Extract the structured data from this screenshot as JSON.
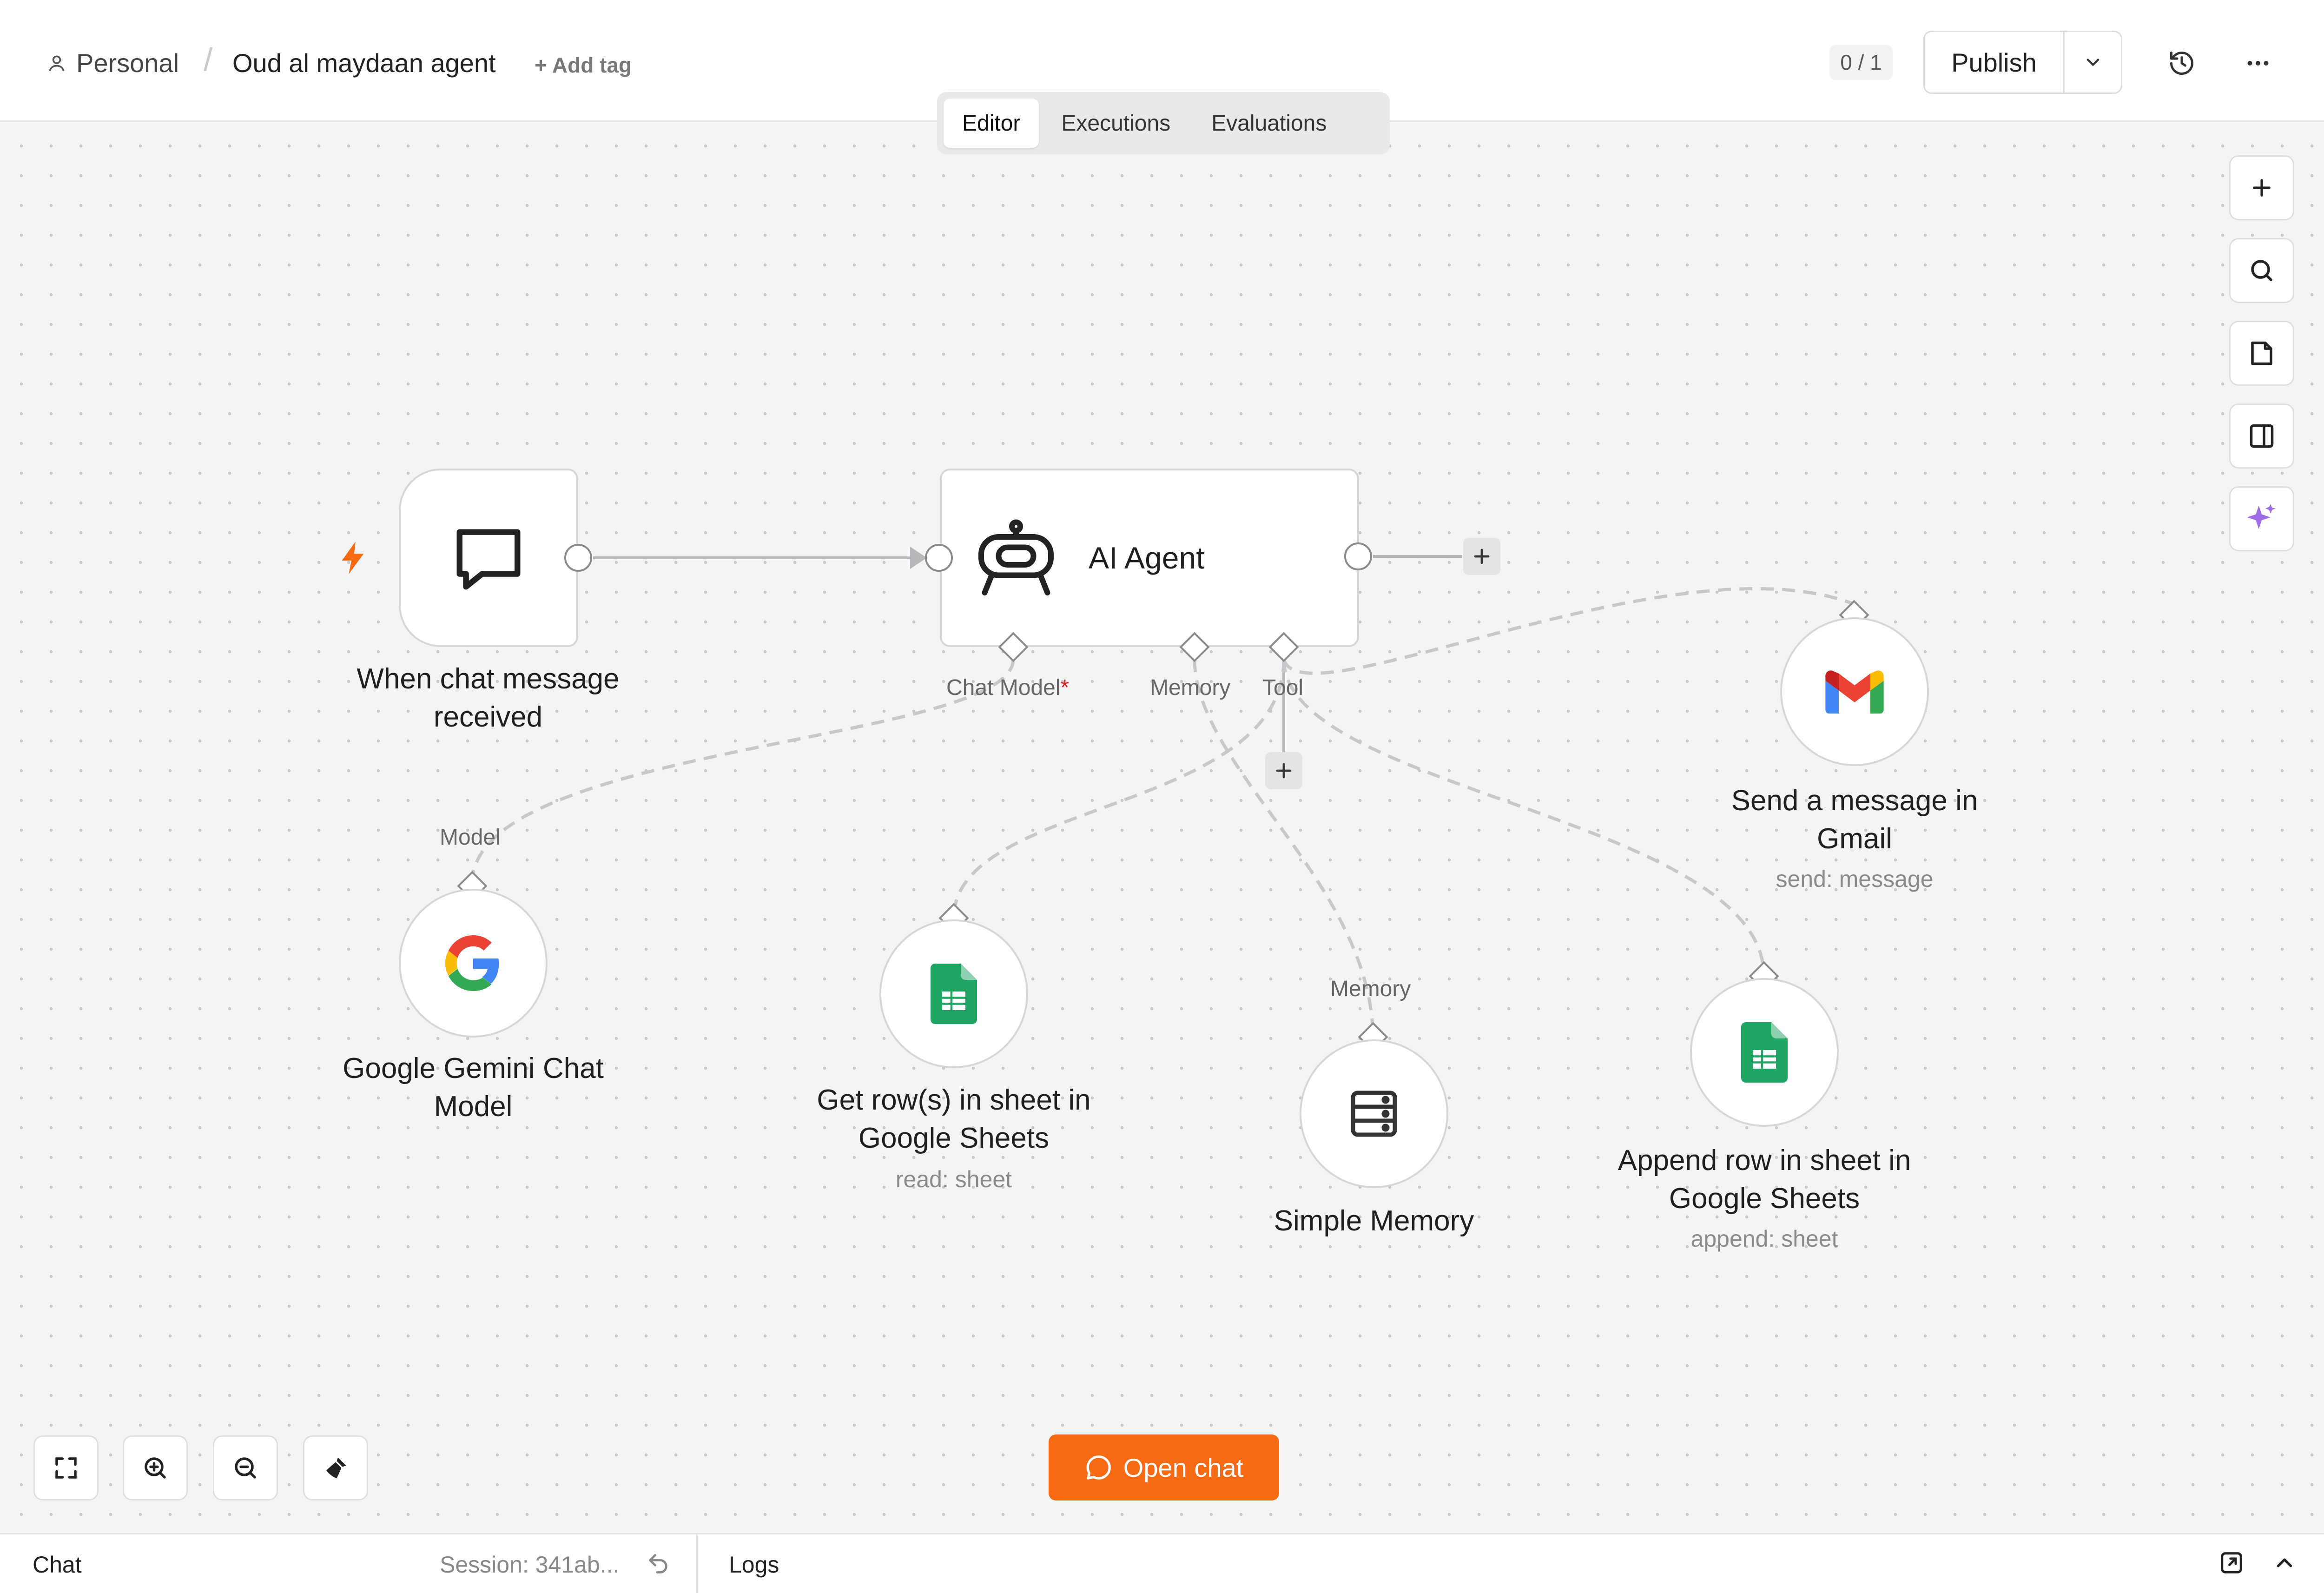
{
  "header": {
    "breadcrumb_project": "Personal",
    "breadcrumb_separator": "/",
    "workflow_name": "Oud al maydaan agent",
    "add_tag": "+ Add tag",
    "counter": "0 / 1",
    "publish_label": "Publish"
  },
  "tabs": [
    "Editor",
    "Executions",
    "Evaluations"
  ],
  "nodes": {
    "trigger": {
      "label": "When chat message received",
      "icon": "chat-bubble-icon"
    },
    "agent": {
      "label": "AI Agent",
      "icon": "robot-icon"
    },
    "gemini": {
      "label": "Google Gemini Chat Model",
      "icon": "google-icon",
      "port_label": "Model"
    },
    "get_rows": {
      "label": "Get row(s) in sheet in Google Sheets",
      "sub": "read: sheet",
      "icon": "google-sheets-icon"
    },
    "memory": {
      "label": "Simple Memory",
      "icon": "database-icon",
      "port_label": "Memory"
    },
    "append_row": {
      "label": "Append row in sheet in Google Sheets",
      "sub": "append: sheet",
      "icon": "google-sheets-icon"
    },
    "gmail": {
      "label": "Send a message in Gmail",
      "sub": "send: message",
      "icon": "gmail-icon"
    }
  },
  "agent_ports": {
    "chat_model": "Chat Model",
    "required_mark": "*",
    "memory": "Memory",
    "tool": "Tool"
  },
  "colors": {
    "accent": "#f56a12",
    "trigger_bolt": "#f56a12",
    "ai_sparkle": "#a06be8",
    "required": "#e02020",
    "sheets_green": "#20a464"
  },
  "open_chat": "Open chat",
  "bottom": {
    "chat": "Chat",
    "session": "Session: 341ab...",
    "logs": "Logs"
  }
}
